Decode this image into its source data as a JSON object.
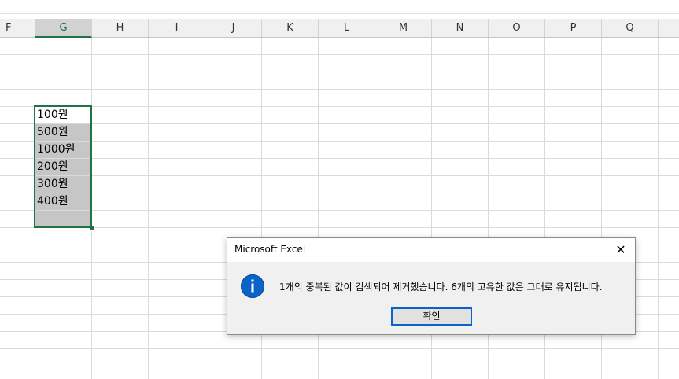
{
  "columns": [
    "F",
    "G",
    "H",
    "I",
    "J",
    "K",
    "L",
    "M",
    "N",
    "O",
    "P",
    "Q"
  ],
  "selected_column": "G",
  "cells": {
    "g7": "100원",
    "g8": "500원",
    "g9": "1000원",
    "g10": "200원",
    "g11": "300원",
    "g12": "400원",
    "g13": ""
  },
  "dialog": {
    "title": "Microsoft Excel",
    "message": "1개의 중복된 값이 검색되어 제거했습니다. 6개의 고유한 값은 그대로 유지됩니다.",
    "ok_label": "확인",
    "close_symbol": "✕",
    "icon": "info-icon"
  },
  "colors": {
    "accent": "#217346",
    "info_icon": "#0a64c8",
    "selected_fill": "#c6c6c6"
  }
}
